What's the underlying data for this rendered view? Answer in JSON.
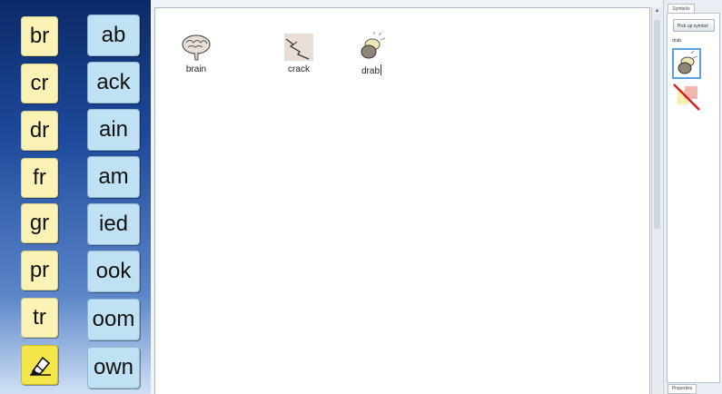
{
  "grid": {
    "onsets": [
      "br",
      "cr",
      "dr",
      "fr",
      "gr",
      "pr",
      "tr"
    ],
    "rimes": [
      "ab",
      "ack",
      "ain",
      "am",
      "ied",
      "ook",
      "oom",
      "own"
    ],
    "eraser_icon": "eraser-icon"
  },
  "document": {
    "symbols": [
      {
        "label": "brain",
        "icon": "brain-icon"
      },
      {
        "label": "crack",
        "icon": "crack-icon"
      },
      {
        "label": "drab",
        "icon": "drab-icon"
      }
    ]
  },
  "side_panel": {
    "tab_label": "Symbols",
    "button_label": "Pick up symbol",
    "current_word": "drab",
    "bottom_tab_label": "Properties"
  },
  "colors": {
    "onset_cell": "#fbf3b6",
    "rime_cell": "#bfe1f3",
    "eraser_cell": "#f3e54a",
    "panel_gradient_top": "#0b2a68",
    "caret": "#1a1aff",
    "selection_border": "#5aa0e6"
  }
}
